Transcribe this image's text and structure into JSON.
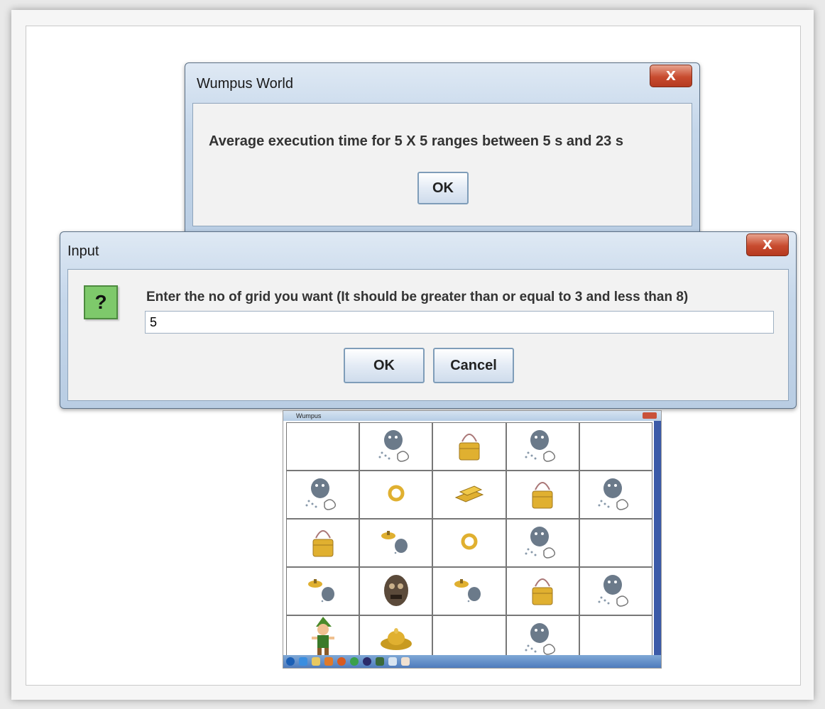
{
  "wumpus_dialog": {
    "title": "Wumpus World",
    "message": "Average execution time for 5 X 5 ranges between 5 s and 23 s",
    "ok_label": "OK",
    "close_label": "X"
  },
  "input_dialog": {
    "title": "Input",
    "prompt": "Enter the no of grid you want (It should be greater than or equal to 3 and less than 8)",
    "value": "5",
    "ok_label": "OK",
    "cancel_label": "Cancel",
    "close_label": "X",
    "icon_glyph": "?"
  },
  "game_window": {
    "title": "Wumpus",
    "grid": [
      [
        "empty",
        "wumpus-stench",
        "pit",
        "wumpus-stench",
        "empty"
      ],
      [
        "wumpus-stench",
        "breeze",
        "gold",
        "pit",
        "wumpus-stench"
      ],
      [
        "pit",
        "stench-breeze",
        "breeze",
        "wumpus-stench",
        "empty"
      ],
      [
        "stench-breeze",
        "wumpus",
        "stench-breeze",
        "pit",
        "wumpus-stench"
      ],
      [
        "agent",
        "gold-pile",
        "empty",
        "wumpus-stench",
        "empty"
      ]
    ]
  },
  "colors": {
    "title_bar": "#c4d6ea",
    "close_button": "#c84b2f",
    "question_icon": "#7ec96b",
    "gold": "#e0b030",
    "stench": "#6b7a8a"
  }
}
